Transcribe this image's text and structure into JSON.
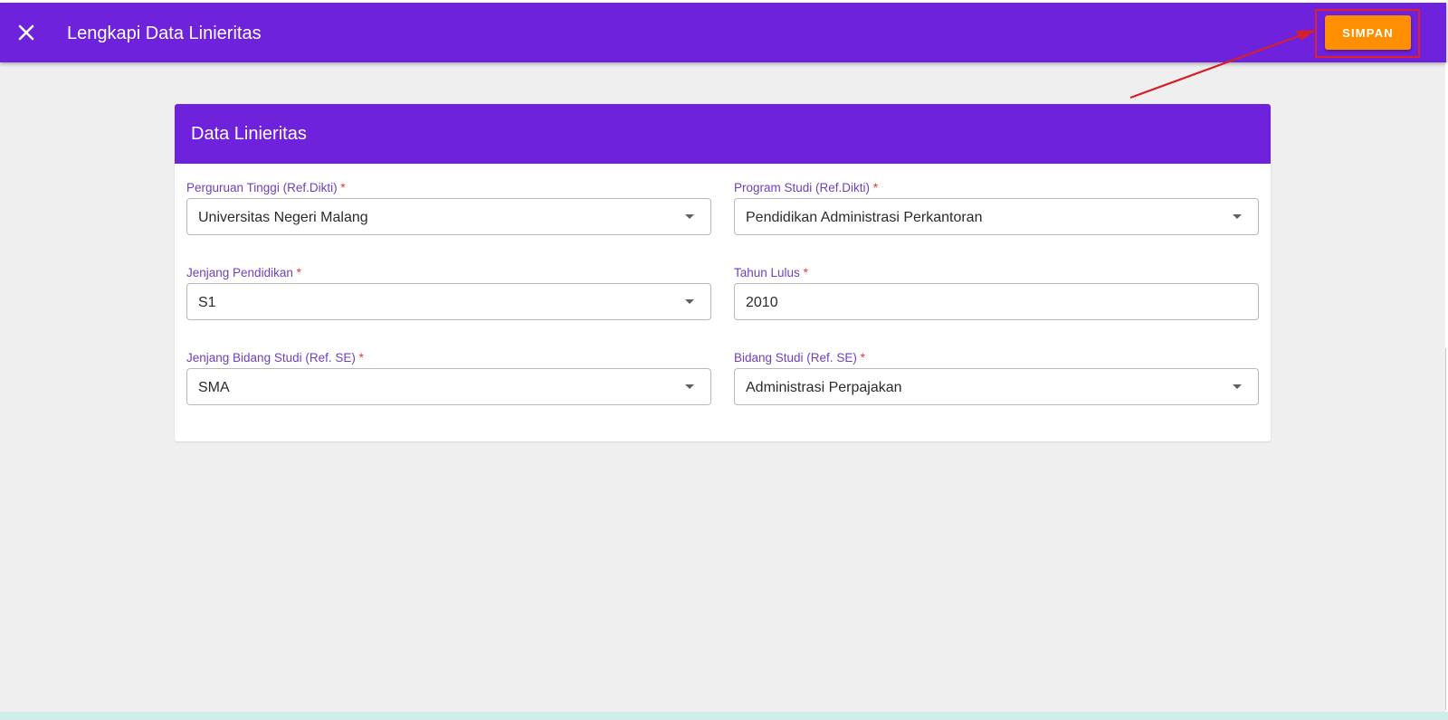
{
  "appbar": {
    "title": "Lengkapi Data Linieritas",
    "close_icon": "close-icon",
    "save_label": "SIMPAN"
  },
  "colors": {
    "primary": "#6f22dc",
    "accent": "#ff8f00",
    "annotation": "#e0202a",
    "label": "#6f3fbf",
    "required": "#e53935"
  },
  "card": {
    "title": "Data Linieritas",
    "fields": {
      "perguruan_tinggi": {
        "label": "Perguruan Tinggi (Ref.Dikti)",
        "required_mark": "*",
        "value": "Universitas Negeri Malang",
        "icon": "chevron-down-icon"
      },
      "program_studi": {
        "label": "Program Studi (Ref.Dikti)",
        "required_mark": "*",
        "value": "Pendidikan Administrasi Perkantoran",
        "icon": "chevron-down-icon"
      },
      "jenjang_pendidikan": {
        "label": "Jenjang Pendidikan",
        "required_mark": "*",
        "value": "S1",
        "icon": "chevron-down-icon"
      },
      "tahun_lulus": {
        "label": "Tahun Lulus",
        "required_mark": "*",
        "value": "2010"
      },
      "jenjang_bidang_studi": {
        "label": "Jenjang Bidang Studi (Ref. SE)",
        "required_mark": "*",
        "value": "SMA",
        "icon": "chevron-down-icon"
      },
      "bidang_studi": {
        "label": "Bidang Studi (Ref. SE)",
        "required_mark": "*",
        "value": "Administrasi Perpajakan",
        "icon": "chevron-down-icon"
      }
    }
  }
}
